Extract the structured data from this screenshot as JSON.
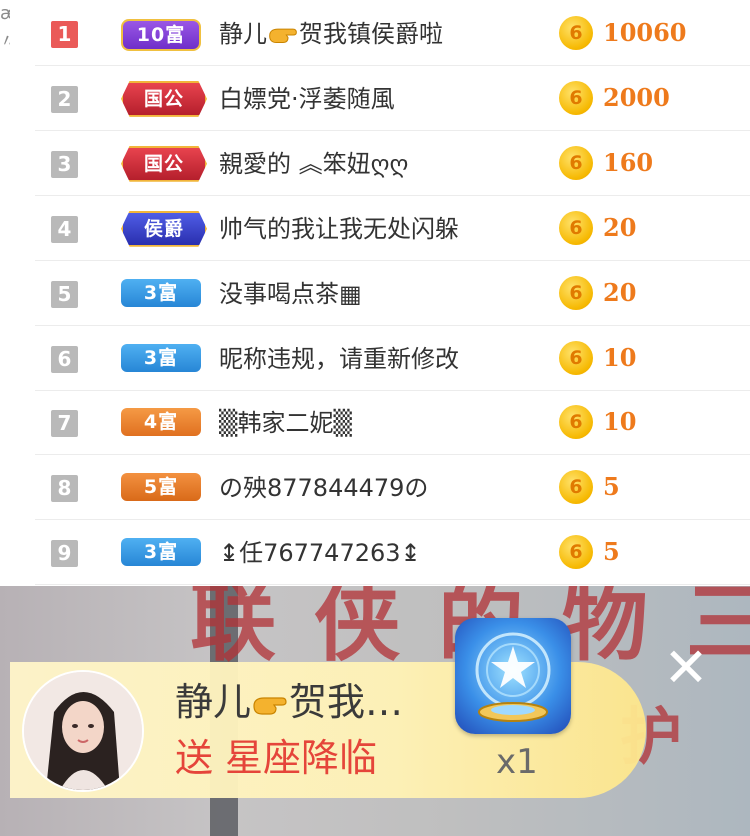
{
  "edge": {
    "chars": "æ\n〃"
  },
  "ranking": [
    {
      "rank": "1",
      "badge": "10富",
      "badge_type": "rich",
      "badge_color": "#8a45dc",
      "name_pre": "静儿",
      "name_post": "贺我镇侯爵啦",
      "has_hand": true,
      "amount": "10060"
    },
    {
      "rank": "2",
      "badge": "国公",
      "badge_type": "noble",
      "badge_color": "#d63a44",
      "name_pre": "白嫖党·浮萎随風",
      "name_post": "",
      "has_hand": false,
      "amount": "2000"
    },
    {
      "rank": "3",
      "badge": "国公",
      "badge_type": "noble",
      "badge_color": "#d63a44",
      "name_pre": "親愛的 ︽笨妞ღღ",
      "name_post": "",
      "has_hand": false,
      "amount": "160"
    },
    {
      "rank": "4",
      "badge": "侯爵",
      "badge_type": "noble",
      "badge_color": "#3a45d0",
      "name_pre": "帅气的我让我无处闪躲",
      "name_post": "",
      "has_hand": false,
      "amount": "20"
    },
    {
      "rank": "5",
      "badge": "3富",
      "badge_type": "rich",
      "badge_color": "#3b9be6",
      "name_pre": "没事喝点茶▦",
      "name_post": "",
      "has_hand": false,
      "amount": "20"
    },
    {
      "rank": "6",
      "badge": "3富",
      "badge_type": "rich",
      "badge_color": "#3b9be6",
      "name_pre": "昵称违规，请重新修改",
      "name_post": "",
      "has_hand": false,
      "amount": "10"
    },
    {
      "rank": "7",
      "badge": "4富",
      "badge_type": "rich",
      "badge_color": "#ee8a35",
      "name_pre": "▒韩家二妮▒",
      "name_post": "",
      "has_hand": false,
      "amount": "10"
    },
    {
      "rank": "8",
      "badge": "5富",
      "badge_type": "rich",
      "badge_color": "#e47c2a",
      "name_pre": "の殃877844479の",
      "name_post": "",
      "has_hand": false,
      "amount": "5"
    },
    {
      "rank": "9",
      "badge": "3富",
      "badge_type": "rich",
      "badge_color": "#3b9be6",
      "name_pre": "↨任767747263↨",
      "name_post": "",
      "has_hand": false,
      "amount": "5"
    }
  ],
  "coin_label": "6",
  "video_text": {
    "line1": "联 侠 的 物 三",
    "line2": "护"
  },
  "gift": {
    "sender": "静儿",
    "sender_suffix": "贺我…",
    "action": "送",
    "gift_name": "星座降临",
    "count": "x1",
    "close": "✕"
  },
  "colors": {
    "accent": "#ee7a1c",
    "gift_action": "#e5453a",
    "rank_top": "#ea5a58",
    "rank_other": "#b9b9b9"
  }
}
